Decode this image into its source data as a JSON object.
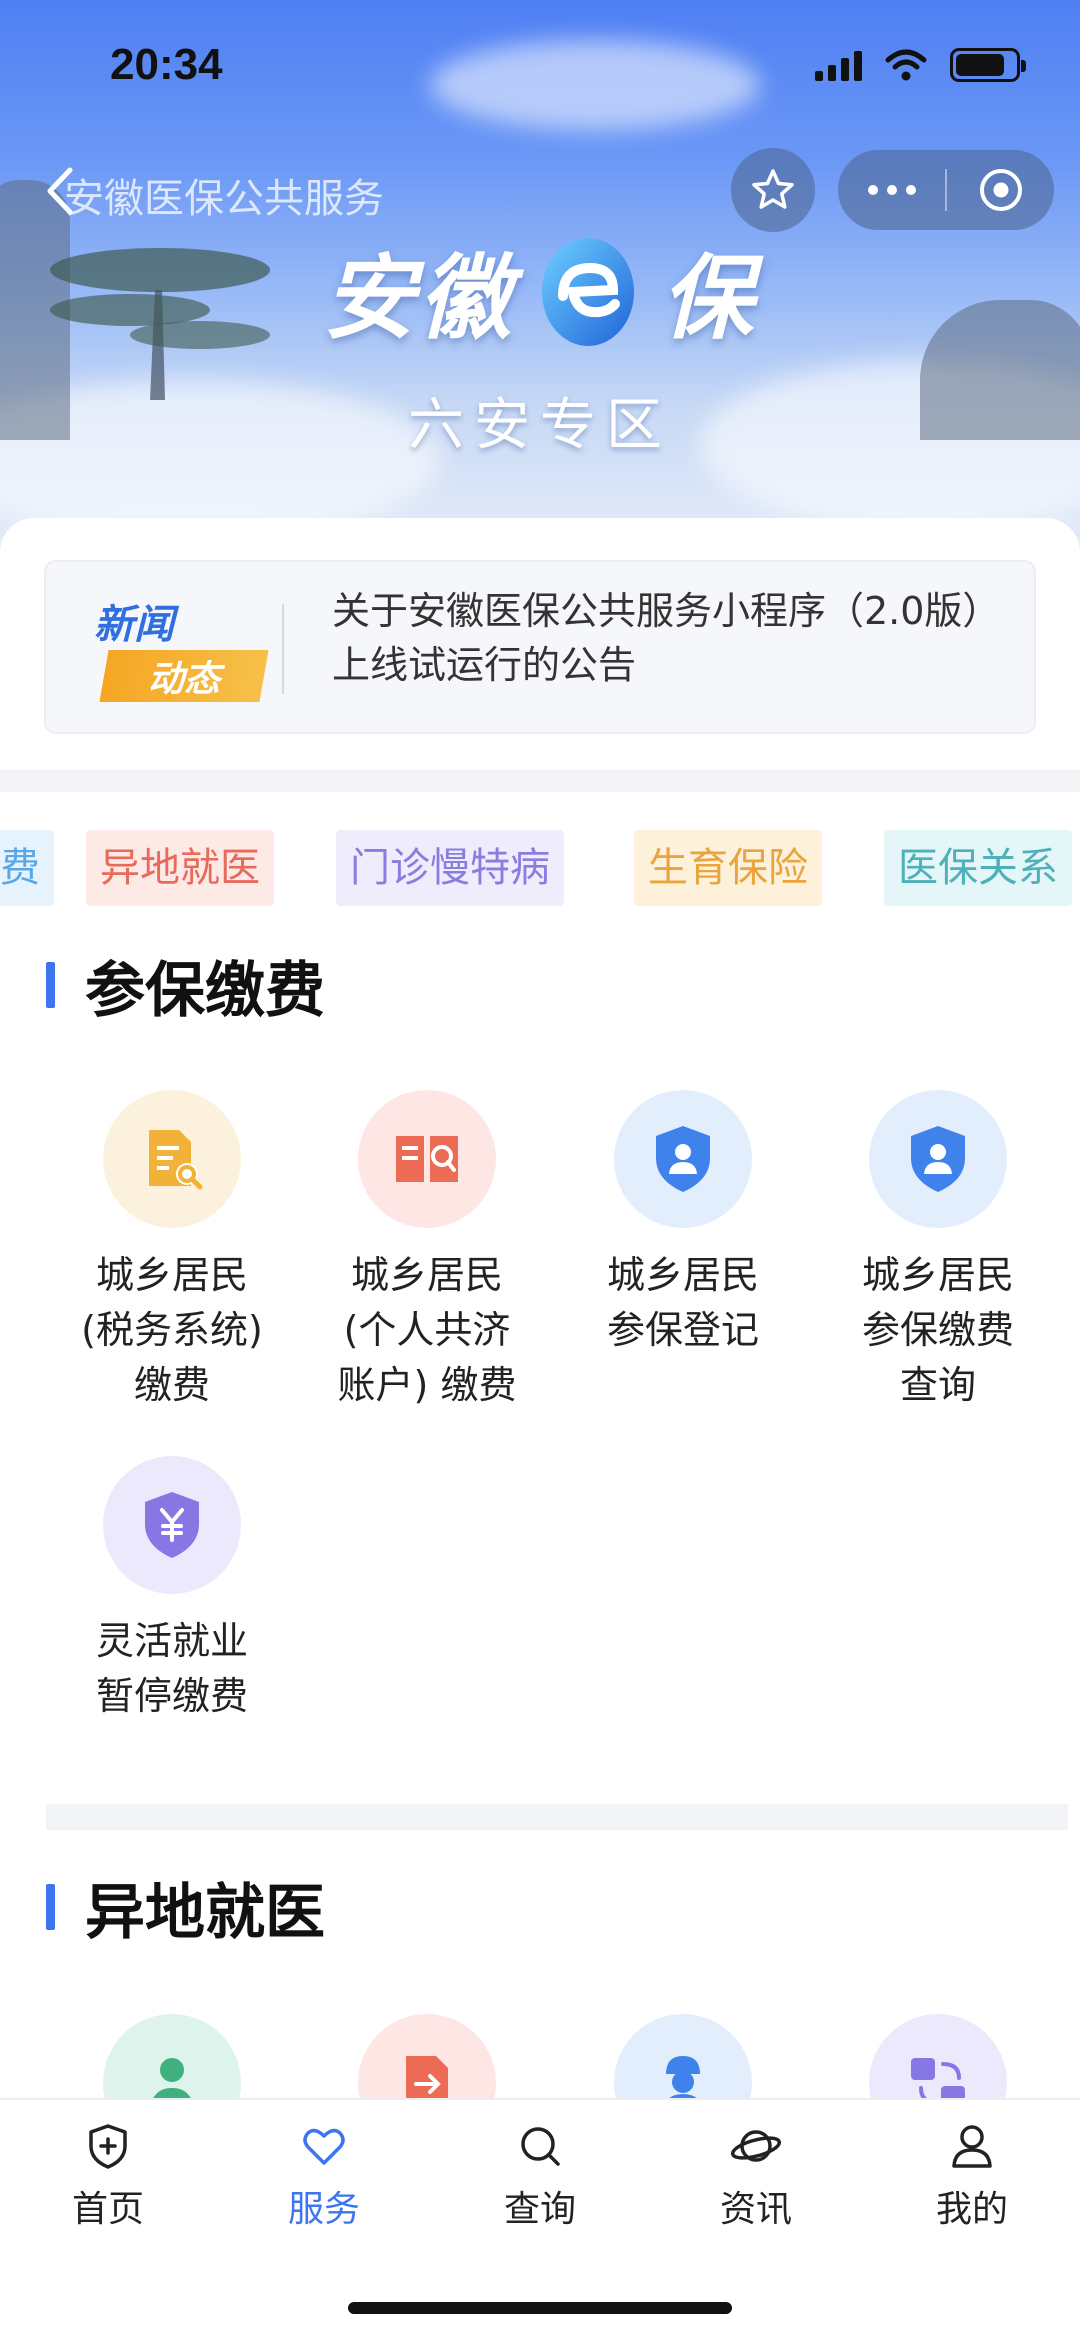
{
  "status_bar": {
    "time": "20:34"
  },
  "nav": {
    "title": "安徽医保公共服务"
  },
  "banner": {
    "logo_left": "安徽",
    "logo_right": "保",
    "subtitle": "六安专区"
  },
  "news": {
    "badge_line1": "新闻",
    "badge_line2": "动态",
    "text": "关于安徽医保公共服务小程序（2.0版） 上线试运行的公告"
  },
  "tags": [
    {
      "label": "费",
      "color": "#5aa7e6",
      "bg": "#e6f2fc"
    },
    {
      "label": "异地就医",
      "color": "#e86a5b",
      "bg": "#fde9e6"
    },
    {
      "label": "门诊慢特病",
      "color": "#8a7de0",
      "bg": "#efedfb"
    },
    {
      "label": "生育保险",
      "color": "#e9a53c",
      "bg": "#fdf1dc"
    },
    {
      "label": "医保关系",
      "color": "#4eb0b8",
      "bg": "#e4f6f7"
    }
  ],
  "sections": [
    {
      "title": "参保缴费",
      "items": [
        {
          "label": "城乡居民\n(税务系统)\n缴费",
          "icon": "tax-document-search-icon",
          "bg": "#fbf1dc",
          "fg": "#f2b23a"
        },
        {
          "label": "城乡居民\n(个人共济\n账户) 缴费",
          "icon": "account-book-search-icon",
          "bg": "#fde6e3",
          "fg": "#ec6b55"
        },
        {
          "label": "城乡居民\n参保登记",
          "icon": "user-shield-icon",
          "bg": "#e3eefd",
          "fg": "#3f82ec"
        },
        {
          "label": "城乡居民\n参保缴费\n查询",
          "icon": "user-shield-icon",
          "bg": "#e3eefd",
          "fg": "#3f82ec"
        },
        {
          "label": "灵活就业\n暂停缴费",
          "icon": "yuan-shield-icon",
          "bg": "#ebe9fb",
          "fg": "#8677e4"
        }
      ]
    },
    {
      "title": "异地就医",
      "items": [
        {
          "label": "",
          "icon": "person-worker-icon",
          "bg": "#def3ec",
          "fg": "#3fb07e"
        },
        {
          "label": "",
          "icon": "travel-document-icon",
          "bg": "#fde6e3",
          "fg": "#ec6b55"
        },
        {
          "label": "",
          "icon": "worker-helmet-icon",
          "bg": "#e3eefd",
          "fg": "#3f82ec"
        },
        {
          "label": "",
          "icon": "transfer-icon",
          "bg": "#ebe9fb",
          "fg": "#8677e4"
        }
      ]
    }
  ],
  "tabbar": [
    {
      "label": "首页",
      "icon": "home-shield-icon",
      "active": false
    },
    {
      "label": "服务",
      "icon": "heart-icon",
      "active": true
    },
    {
      "label": "查询",
      "icon": "search-icon",
      "active": false
    },
    {
      "label": "资讯",
      "icon": "planet-icon",
      "active": false
    },
    {
      "label": "我的",
      "icon": "user-icon",
      "active": false
    }
  ]
}
